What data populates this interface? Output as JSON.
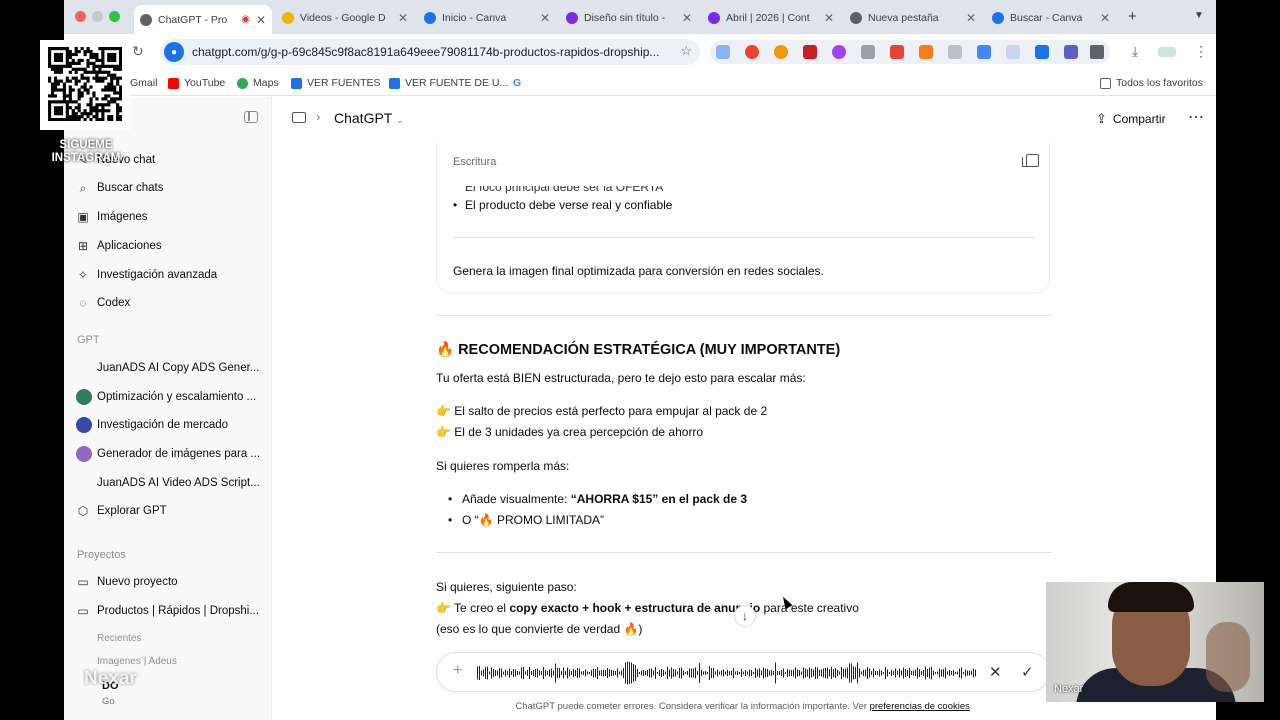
{
  "browser": {
    "tabs": [
      {
        "title": "ChatGPT - Pro",
        "color": "#5f6368",
        "active": true
      },
      {
        "title": "Videos - Google D",
        "color": "#f4b400"
      },
      {
        "title": "Inicio - Canva",
        "color": "#1a73e8"
      },
      {
        "title": "Diseño sin título -",
        "color": "#7d2ae8"
      },
      {
        "title": "Abril | 2026 | Cont",
        "color": "#7d2ae8"
      },
      {
        "title": "Nueva pestaña",
        "color": "#5f6368"
      },
      {
        "title": "Buscar - Canva",
        "color": "#1a73e8"
      }
    ],
    "url": "chatgpt.com/g/g-p-69c845c9f8ac8191a649eee79081174b-productos-rapidos-dropship...",
    "bookmarks": [
      "Gmail",
      "YouTube",
      "Maps",
      "VER FUENTES",
      "VER FUENTE DE U...",
      "Todos los favoritos"
    ]
  },
  "sidebar": {
    "items": [
      {
        "label": "Nuevo chat",
        "icon": "new-chat-icon"
      },
      {
        "label": "Buscar chats",
        "icon": "search-icon"
      },
      {
        "label": "Imágenes",
        "icon": "image-icon"
      },
      {
        "label": "Aplicaciones",
        "icon": "apps-icon"
      },
      {
        "label": "Investigación avanzada",
        "icon": "research-icon"
      },
      {
        "label": "Codex",
        "icon": "codex-icon"
      }
    ],
    "gpt_heading": "GPT",
    "gpts": [
      {
        "label": "JuanADS AI Copy ADS Gener..."
      },
      {
        "label": "Optimización y escalamiento ..."
      },
      {
        "label": "Investigación de mercado"
      },
      {
        "label": "Generador de imágenes para ..."
      },
      {
        "label": "JuanADS AI Video ADS Script..."
      },
      {
        "label": "Explorar GPT"
      }
    ],
    "projects_heading": "Proyectos",
    "projects": [
      {
        "label": "Nuevo proyecto"
      },
      {
        "label": "Productos | Rápidos | Dropshi..."
      }
    ],
    "recent_heading": "Recientes",
    "recent_item": "Imagenes | Adeus",
    "user_name": "DO",
    "user_plan": "Go"
  },
  "topbar": {
    "model": "ChatGPT",
    "share": "Compartir"
  },
  "main": {
    "card": {
      "label": "Escritura",
      "bullets": [
        "El foco principal debe ser la OFERTA",
        "El producto debe verse real y confiable"
      ],
      "final": "Genera la imagen final optimizada para conversión en redes sociales."
    },
    "heading": "🔥 RECOMENDACIÓN ESTRATÉGICA (MUY IMPORTANTE)",
    "intro": "Tu oferta está BIEN estructurada, pero te dejo esto para escalar más:",
    "point1": "👉 El salto de precios está perfecto para empujar al pack de 2",
    "point2": "👉 El de 3 unidades ya crea percepción de ahorro",
    "romper": "Si quieres romperla más:",
    "li1_a": "Añade visualmente: ",
    "li1_b": "“AHORRA $15” en el pack de 3",
    "li2": "O “🔥 PROMO LIMITADA”",
    "next": "Si quieres, siguiente paso:",
    "step_a": "👉 Te creo el ",
    "step_b": "copy exacto + hook + estructura de anuncio",
    "step_c": " para este creativo",
    "step2": "(eso es lo que convierte de verdad 🔥)",
    "disclaimer_a": "ChatGPT puede cometer errores. Considera verificar la información importante. Ver ",
    "disclaimer_link": "preferencias de cookies",
    "disclaimer_b": "."
  },
  "overlay": {
    "social_line1": "SIGUEME",
    "social_line2": "INSTAGRAM",
    "watermark": "Nexar",
    "webcam_name": "Nexar"
  }
}
